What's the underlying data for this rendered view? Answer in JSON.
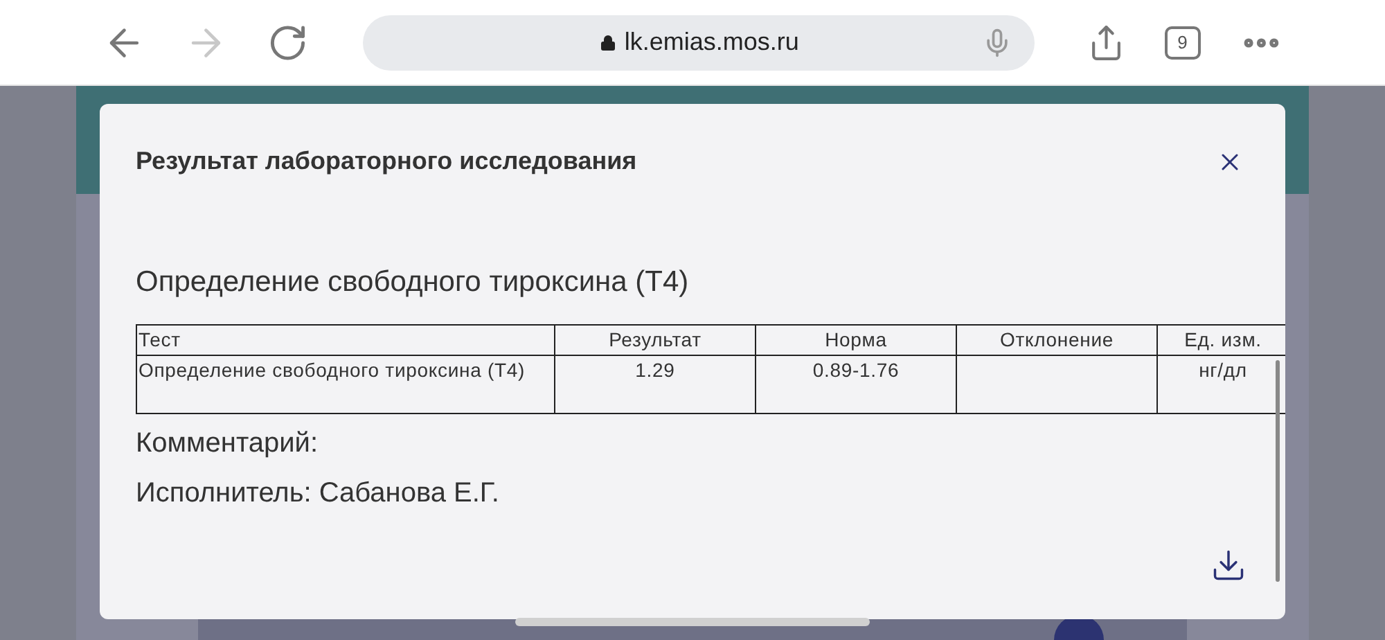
{
  "browser": {
    "url": "lk.emias.mos.ru",
    "tab_count": "9",
    "forward_disabled": true
  },
  "modal": {
    "title": "Результат лабораторного исследования",
    "test_heading": "Определение свободного тироксина (Т4)",
    "table": {
      "columns": [
        "Тест",
        "Результат",
        "Норма",
        "Отклонение",
        "Ед. изм."
      ],
      "rows": [
        [
          "Определение свободного тироксина (Т4)",
          "1.29",
          "0.89-1.76",
          "",
          "нг/дл"
        ]
      ]
    },
    "comment_label": "Комментарий:",
    "performer": "Исполнитель: Сабанова Е.Г."
  }
}
